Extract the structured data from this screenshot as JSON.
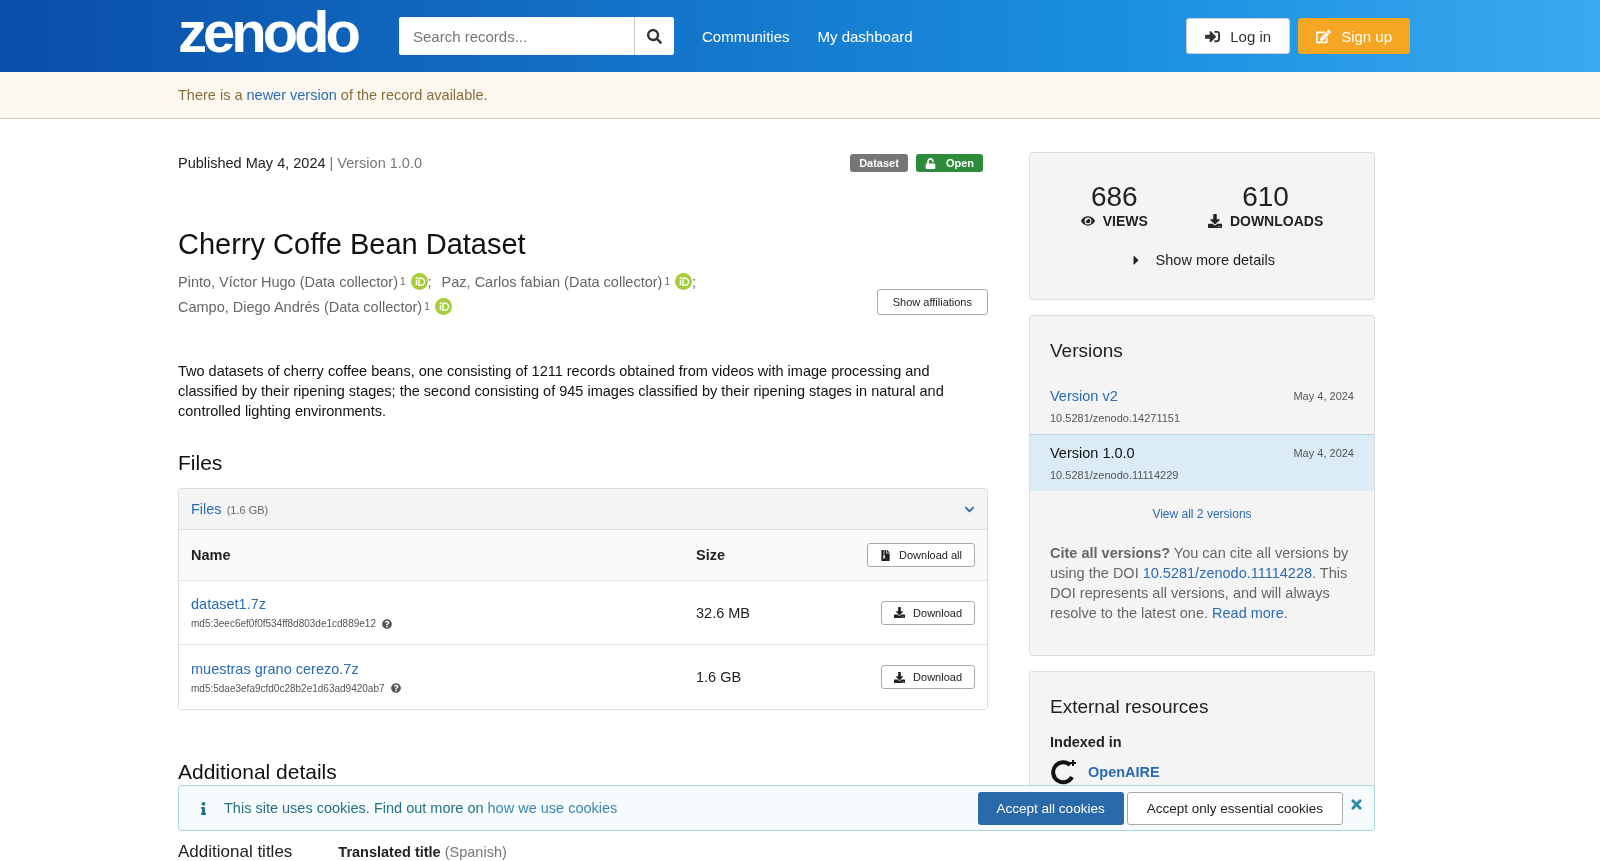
{
  "header": {
    "logo": "zenodo",
    "search": {
      "placeholder": "Search records..."
    },
    "nav": [
      "Communities",
      "My dashboard"
    ],
    "login": "Log in",
    "signup": "Sign up"
  },
  "notice": {
    "before": "There is a",
    "link": "newer version",
    "after": "of the record available."
  },
  "record": {
    "published_label": "Published",
    "date": "May 4, 2024",
    "separator": "|",
    "version": "Version 1.0.0",
    "badges": [
      {
        "label": "Dataset",
        "kind": "type"
      },
      {
        "label": "Open",
        "kind": "access"
      }
    ],
    "title": "Cherry Coffe Bean Dataset",
    "creators": [
      {
        "name": "Pinto, Víctor Hugo (Data collector)",
        "affiliation": "1",
        "separator": ";"
      },
      {
        "name": "Paz, Carlos fabian (Data collector)",
        "affiliation": "1",
        "separator": ";"
      },
      {
        "name": "Campo, Diego Andrés (Data collector)",
        "affiliation": "1"
      }
    ],
    "show_affiliations": "Show affiliations",
    "description": "Two datasets of cherry coffee beans, one consisting of 1211 records obtained from videos with image processing and classified by their ripening stages; the second consisting of 945 images classified by their ripening stages in natural and controlled lighting environments.",
    "files_heading": "Files",
    "files": {
      "title": "Files",
      "total": "(1.6 GB)",
      "expanded": true,
      "columns": [
        "Name",
        "Size"
      ],
      "download_all": "Download all",
      "rows": [
        {
          "name": "dataset1.7z",
          "checksum": "md5:3eec6ef0f0f534ff8d803de1cd889e12",
          "size": "32.6 MB",
          "action": "Download"
        },
        {
          "name": "muestras grano cerezo.7z",
          "checksum": "md5:5dae3efa9cfd0c28b2e1d63ad9420ab7",
          "size": "1.6 GB",
          "action": "Download"
        }
      ]
    },
    "additional_heading": "Additional details",
    "additional": {
      "label": "Additional titles",
      "field": "Translated title",
      "lang": "(Spanish)"
    }
  },
  "sidebar": {
    "stats": [
      {
        "value": "686",
        "label": "VIEWS",
        "kind": "views"
      },
      {
        "value": "610",
        "label": "DOWNLOADS",
        "kind": "downloads"
      }
    ],
    "more": "Show more details",
    "versions": {
      "title": "Versions",
      "items": [
        {
          "label": "Version v2",
          "doi": "10.5281/zenodo.14271151",
          "date": "May 4, 2024",
          "selected": false
        },
        {
          "label": "Version 1.0.0",
          "doi": "10.5281/zenodo.11114229",
          "date": "May 4, 2024",
          "selected": true
        }
      ],
      "view_all": "View all 2 versions",
      "cite": {
        "bold": "Cite all versions?",
        "text1": "You can cite all versions by using the DOI",
        "doi": "10.5281/zenodo.11114228",
        "text2": ". This DOI represents all versions, and will always resolve to the latest one.",
        "link": "Read more",
        "end": "."
      }
    },
    "external": {
      "title": "External resources",
      "indexed": "Indexed in",
      "items": [
        {
          "name": "OpenAIRE"
        }
      ]
    }
  },
  "cookie": {
    "text": "This site uses cookies. Find out more on",
    "link": "how we use cookies",
    "accept": "Accept all cookies",
    "essential": "Accept only essential cookies"
  }
}
